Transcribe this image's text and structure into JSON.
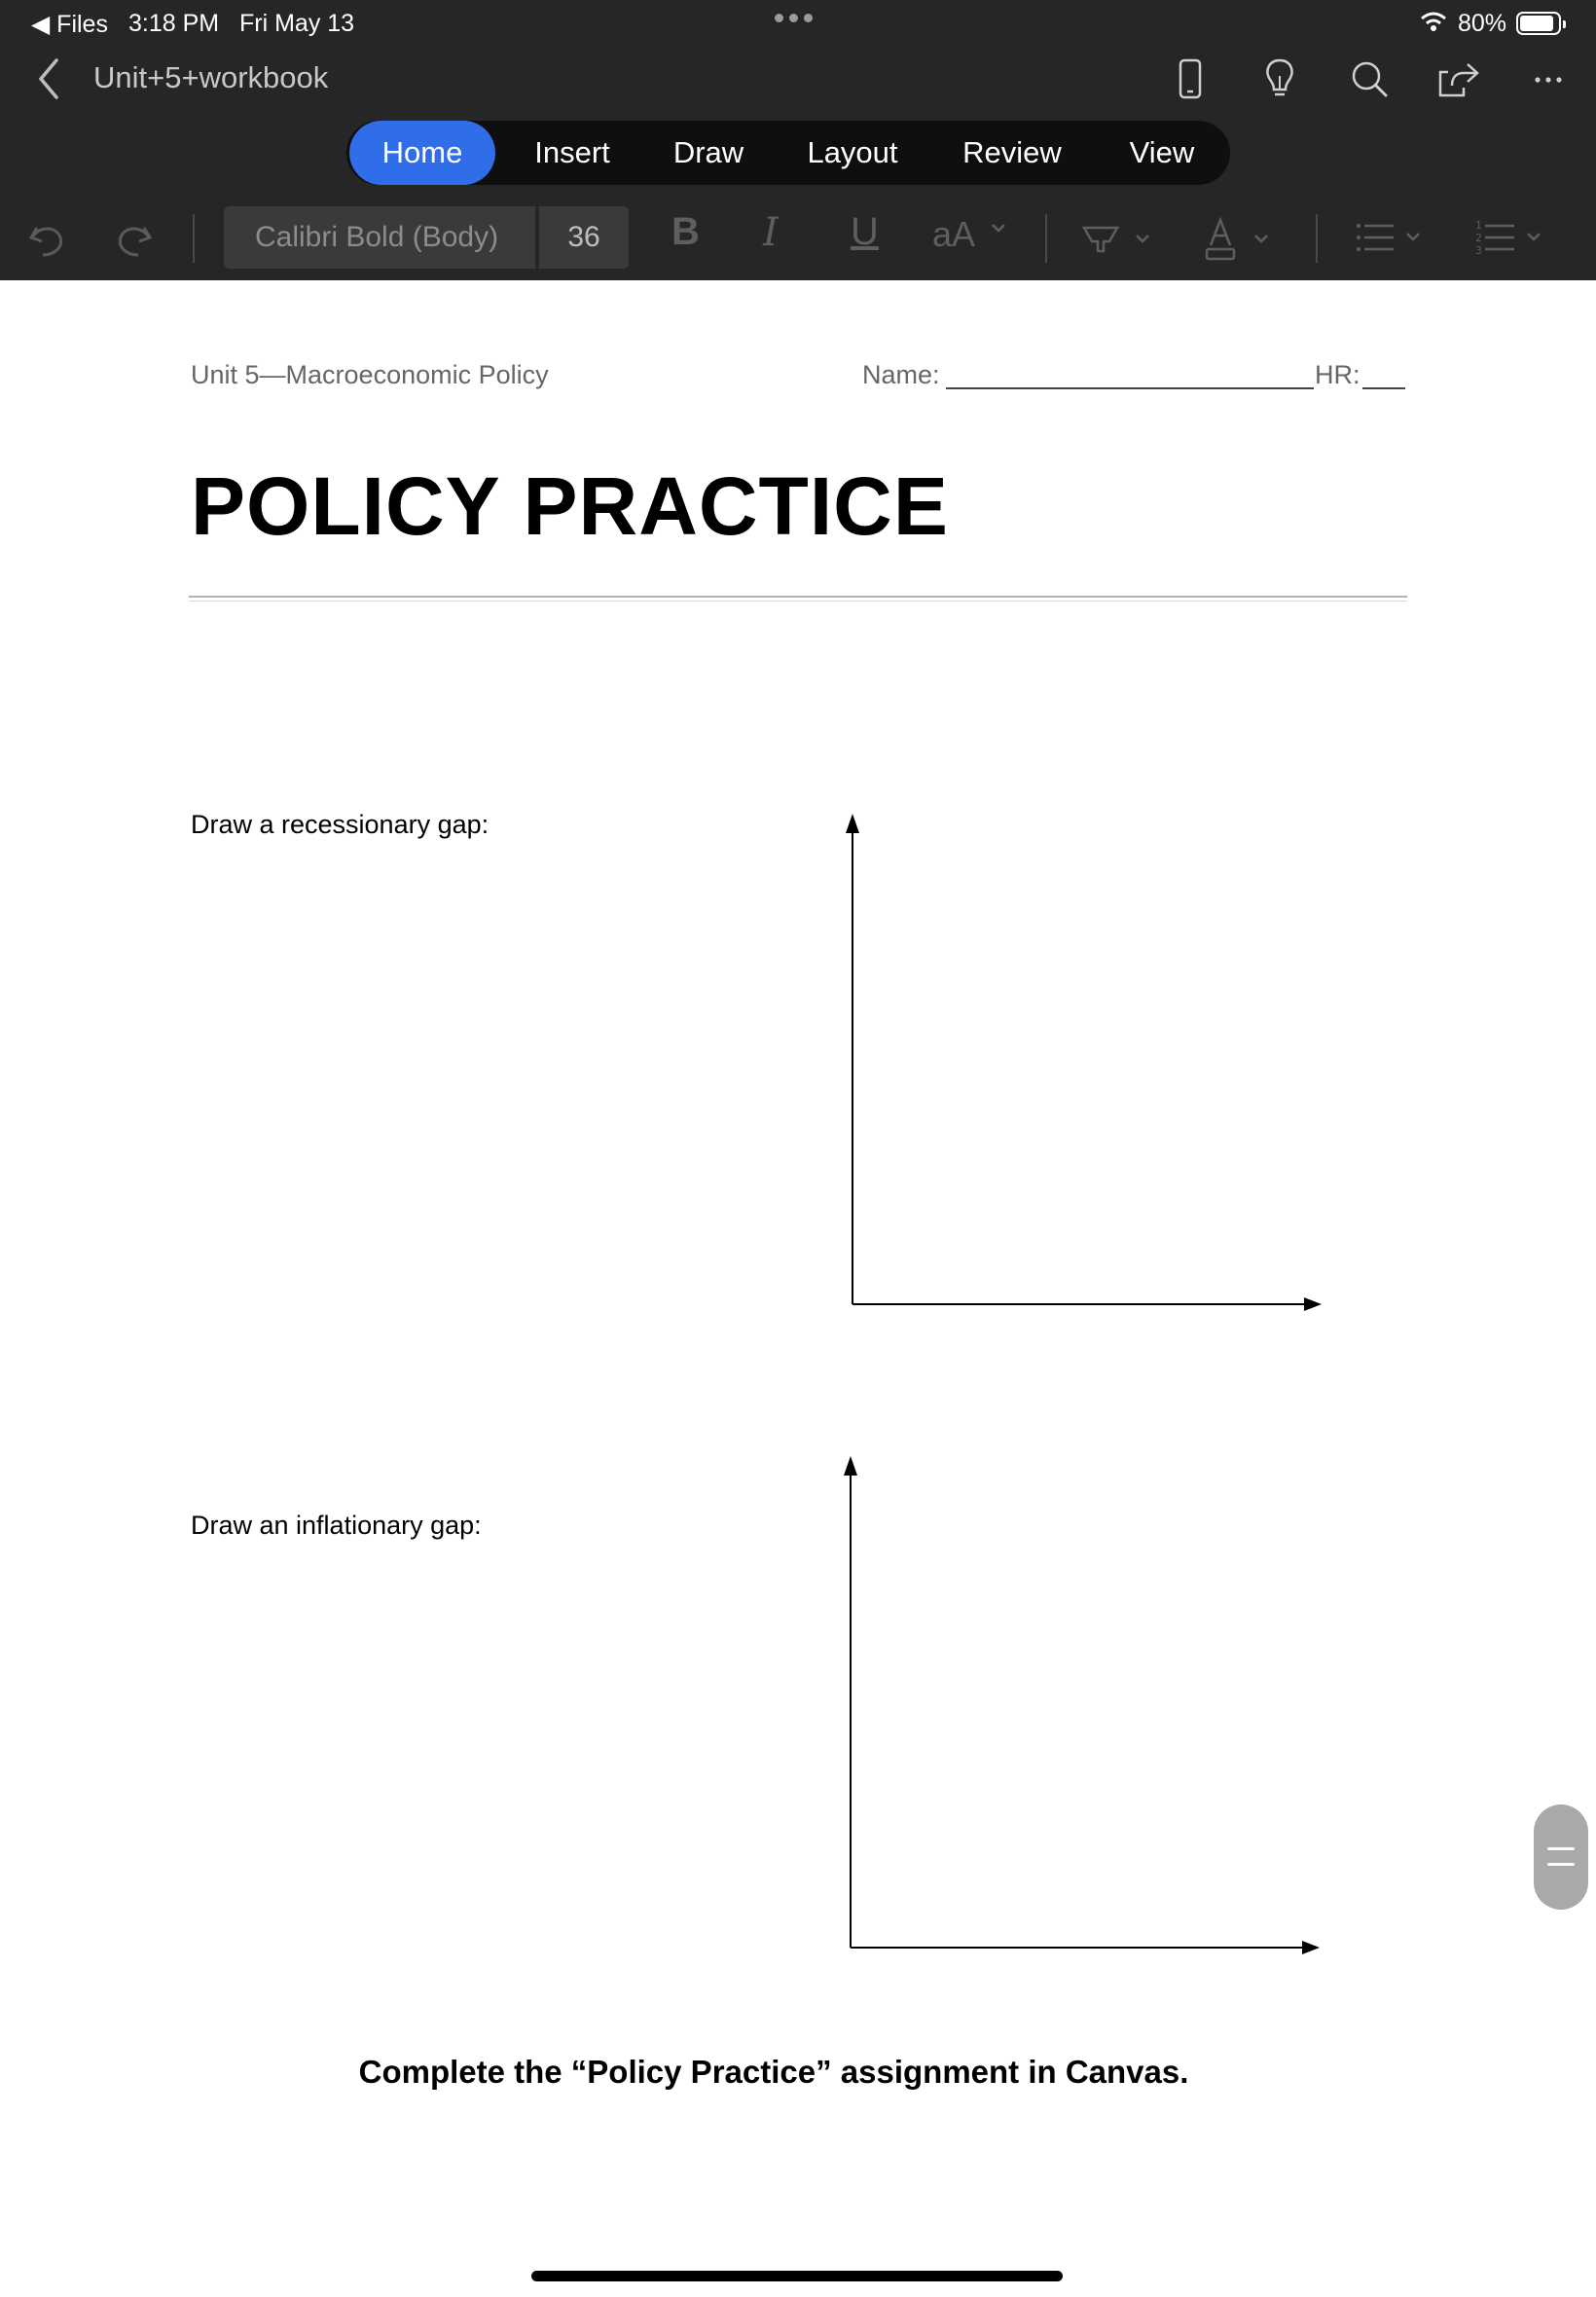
{
  "status_bar": {
    "back_app": "◀ Files",
    "time": "3:18 PM",
    "date": "Fri May 13",
    "battery": "80%",
    "battery_level": 0.8
  },
  "titlebar": {
    "doc_title": "Unit+5+workbook",
    "icons": [
      "back-chevron-icon",
      "phone-layout-icon",
      "lightbulb-icon",
      "search-icon",
      "share-icon",
      "more-icon"
    ]
  },
  "ribbon": {
    "tabs": [
      "Home",
      "Insert",
      "Draw",
      "Layout",
      "Review",
      "View"
    ],
    "active_tab": "Home"
  },
  "format_bar": {
    "font_name": "Calibri Bold (Body)",
    "font_size": "36",
    "bold": "B",
    "italic": "I",
    "underline": "U",
    "font_case": "aA",
    "icons": [
      "undo-icon",
      "redo-icon",
      "highlighter-icon",
      "font-color-icon",
      "bullets-icon",
      "numbering-icon"
    ]
  },
  "document": {
    "header_left": "Unit 5—Macroeconomic Policy",
    "name_label": "Name:",
    "hr_label": "HR:",
    "heading": "POLICY PRACTICE",
    "prompt1": "Draw a recessionary gap:",
    "prompt2": "Draw an inflationary gap:",
    "footer_note": "Complete the “Policy Practice” assignment in Canvas."
  },
  "colors": {
    "toolbar_bg": "#262627",
    "active_tab": "#2f6ee8",
    "page_bg": "#ffffff"
  }
}
